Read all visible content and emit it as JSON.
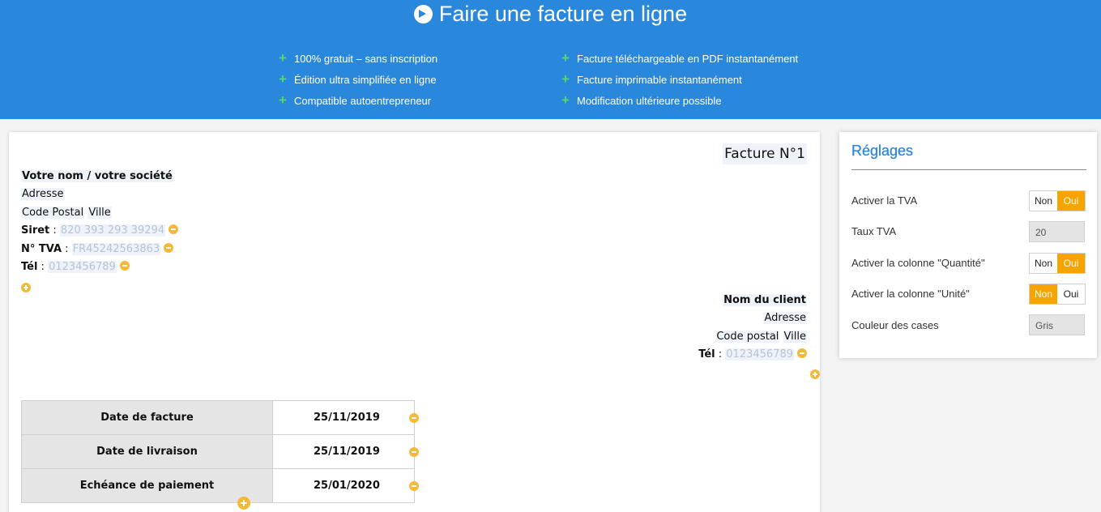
{
  "banner": {
    "title": "Faire une facture en ligne",
    "features_left": [
      "100% gratuit – sans inscription",
      "Édition ultra simplifiée en ligne",
      "Compatible autoentrepreneur"
    ],
    "features_right": [
      "Facture téléchargeable en PDF instantanément",
      "Facture imprimable instantanément",
      "Modification ultérieure possible"
    ]
  },
  "invoice": {
    "title": "Facture N°1",
    "seller": {
      "name": "Votre nom / votre société",
      "address": "Adresse",
      "postal_code": "Code Postal",
      "city": "Ville",
      "siret_label": "Siret",
      "siret_placeholder": "820 393 293 39294",
      "tva_label": "N° TVA",
      "tva_placeholder": "FR45242563863",
      "tel_label": "Tél",
      "tel_placeholder": "0123456789"
    },
    "client": {
      "name": "Nom du client",
      "address": "Adresse",
      "postal_code": "Code postal",
      "city": "Ville",
      "tel_label": "Tél",
      "tel_placeholder": "0123456789"
    },
    "dates": [
      {
        "label": "Date de facture",
        "value": "25/11/2019"
      },
      {
        "label": "Date de livraison",
        "value": "25/11/2019"
      },
      {
        "label": "Echéance de paiement",
        "value": "25/01/2020"
      }
    ]
  },
  "settings": {
    "title": "Réglages",
    "rows": [
      {
        "label": "Activer la TVA",
        "off": "Non",
        "on": "Oui",
        "selected": "on"
      },
      {
        "label": "Taux TVA",
        "value": "20"
      },
      {
        "label": "Activer la colonne \"Quantité\"",
        "off": "Non",
        "on": "Oui",
        "selected": "on"
      },
      {
        "label": "Activer la colonne \"Unité\"",
        "off": "Non",
        "on": "Oui",
        "selected": "off"
      },
      {
        "label": "Couleur des cases",
        "value": "Gris"
      }
    ],
    "accent_color": "#f7a400"
  },
  "colors": {
    "banner": "#2a88dc",
    "plus": "#53d96a",
    "action": "#f5b93a"
  }
}
